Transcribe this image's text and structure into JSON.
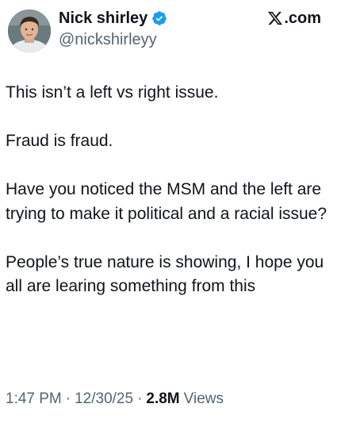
{
  "header": {
    "display_name": "Nick shirley",
    "handle": "@nickshirleyy",
    "verified": true,
    "brand_text": ".com"
  },
  "tweet": {
    "paragraphs": [
      "This isn’t a left vs right issue.",
      "Fraud is fraud.",
      "Have you noticed the MSM and the left are trying to make it political and a racial issue?",
      "People’s true nature is showing, I hope you all are learing something from this"
    ]
  },
  "meta": {
    "time": "1:47 PM",
    "date": "12/30/25",
    "views_count": "2.8M",
    "views_label": "Views",
    "separator": "·"
  },
  "colors": {
    "text": "#0f1419",
    "secondary": "#536471",
    "verified_badge": "#1d9bf0"
  }
}
